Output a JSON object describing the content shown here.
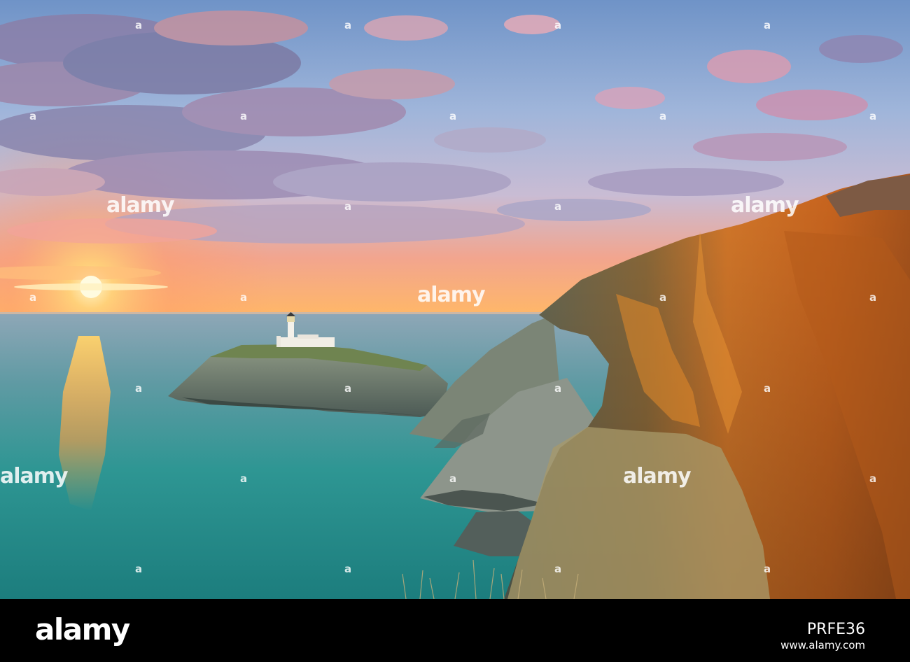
{
  "watermark": {
    "logo": "alamy",
    "mark": "a"
  },
  "footer": {
    "logo": "alamy",
    "image_ref": "PRFE36",
    "url": "www.alamy.com"
  },
  "colors": {
    "sky_top": "#7fa0cc",
    "sky_mid": "#b8c3dd",
    "sun_glow": "#ffb45a",
    "sea": "#2f9a96",
    "cliff_orange": "#d97a24",
    "footer_bg": "#000000"
  }
}
